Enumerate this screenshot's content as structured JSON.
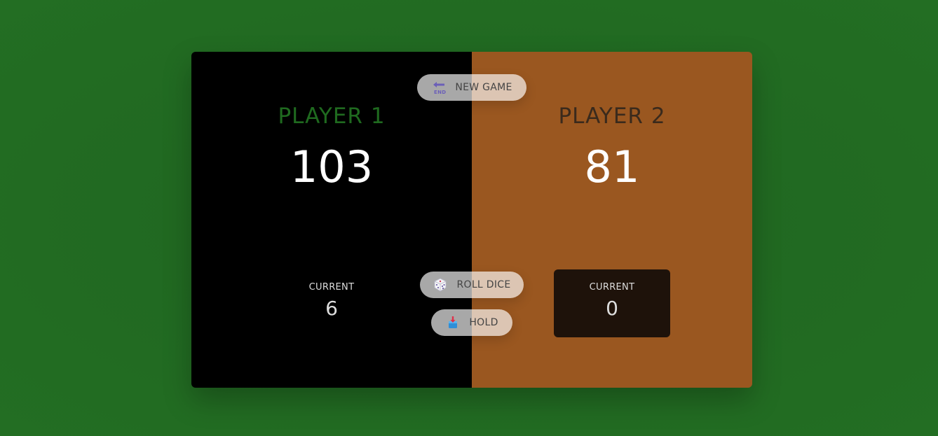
{
  "players": [
    {
      "name": "PLAYER 1",
      "score": "103",
      "current_label": "CURRENT",
      "current": "6",
      "active": true
    },
    {
      "name": "PLAYER 2",
      "score": "81",
      "current_label": "CURRENT",
      "current": "0",
      "active": false
    }
  ],
  "buttons": {
    "new_game": "NEW GAME",
    "roll_dice": "ROLL DICE",
    "hold": "HOLD"
  },
  "icons": {
    "new_game": "end-arrow-icon",
    "roll_dice": "dice-icon",
    "hold": "hold-box-icon"
  },
  "colors": {
    "background": "#226b22",
    "player_1_panel": "#000000",
    "player_2_panel": "#9a5720",
    "player_1_name": "#1f6a1f",
    "player_2_name": "#3a2a1c"
  }
}
